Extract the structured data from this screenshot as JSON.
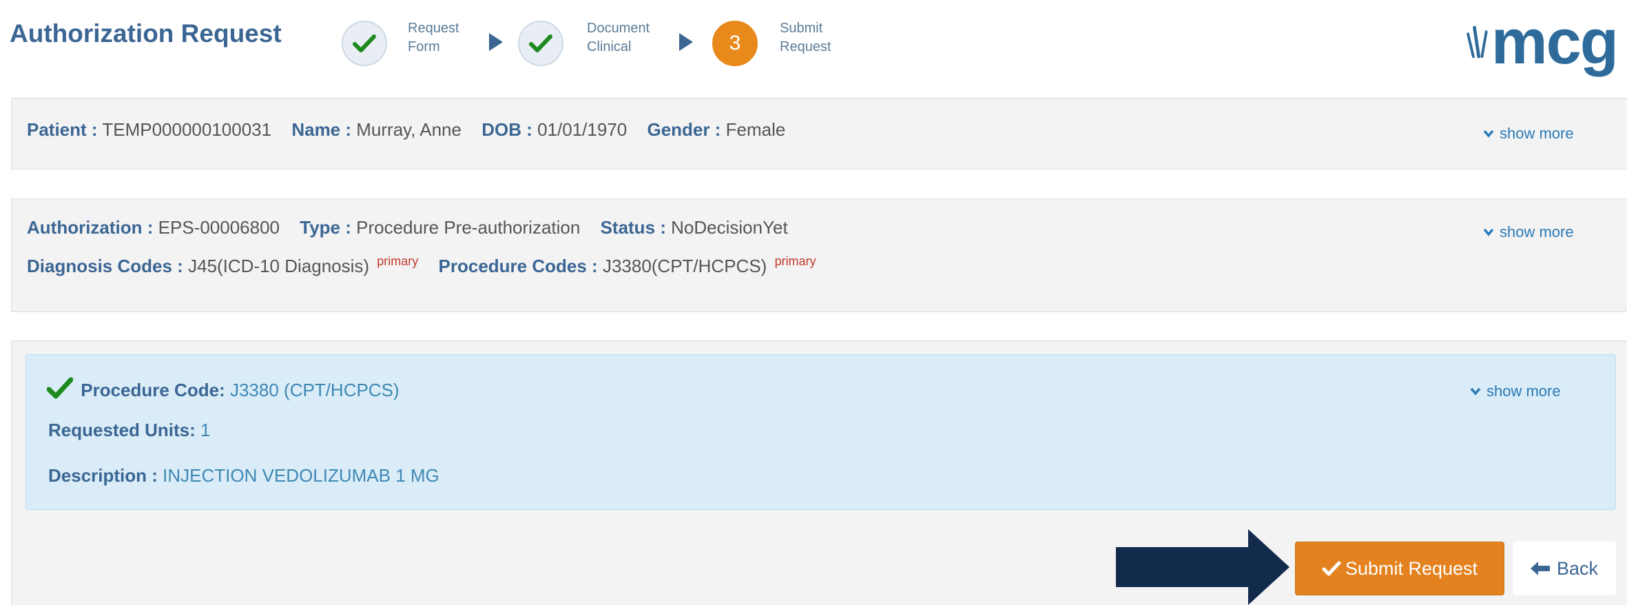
{
  "header": {
    "title": "Authorization Request",
    "steps": [
      {
        "line1": "Request",
        "line2": "Form",
        "state": "done"
      },
      {
        "line1": "Document",
        "line2": "Clinical",
        "state": "done"
      },
      {
        "number": "3",
        "line1": "Submit",
        "line2": "Request",
        "state": "current"
      }
    ],
    "logo_text": "mcg"
  },
  "patient": {
    "patient_label": "Patient :",
    "patient_value": "TEMP000000100031",
    "name_label": "Name :",
    "name_value": "Murray, Anne",
    "dob_label": "DOB :",
    "dob_value": "01/01/1970",
    "gender_label": "Gender :",
    "gender_value": "Female",
    "show_more": "show more"
  },
  "authorization": {
    "auth_label": "Authorization :",
    "auth_value": "EPS-00006800",
    "type_label": "Type :",
    "type_value": "Procedure Pre-authorization",
    "status_label": "Status :",
    "status_value": "NoDecisionYet",
    "diag_label": "Diagnosis Codes :",
    "diag_value": "J45(ICD-10 Diagnosis)",
    "diag_tag": "primary",
    "proc_label": "Procedure Codes :",
    "proc_value": "J3380(CPT/HCPCS)",
    "proc_tag": "primary",
    "show_more": "show more"
  },
  "procedure": {
    "code_label": "Procedure Code:",
    "code_value": "J3380 (CPT/HCPCS)",
    "units_label": "Requested Units:",
    "units_value": "1",
    "desc_label": "Description :",
    "desc_value": "INJECTION VEDOLIZUMAB 1 MG",
    "show_more": "show more"
  },
  "actions": {
    "submit_label": "Submit Request",
    "back_label": "Back"
  },
  "colors": {
    "accent_blue": "#3b6694",
    "current_step_orange": "#e8891c",
    "submit_orange": "#e3821e",
    "check_green": "#1e8a1e",
    "annotation_arrow": "#122a4c"
  }
}
